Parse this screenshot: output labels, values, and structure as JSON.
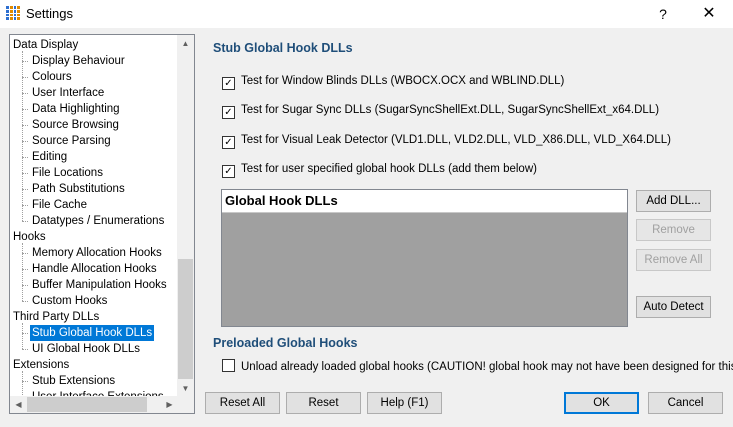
{
  "window": {
    "title": "Settings",
    "help": "?",
    "close": "✕"
  },
  "tree": {
    "items": [
      {
        "label": "Data Display",
        "level": 0
      },
      {
        "label": "Display Behaviour",
        "level": 1
      },
      {
        "label": "Colours",
        "level": 1
      },
      {
        "label": "User Interface",
        "level": 1
      },
      {
        "label": "Data Highlighting",
        "level": 1
      },
      {
        "label": "Source Browsing",
        "level": 1
      },
      {
        "label": "Source Parsing",
        "level": 1
      },
      {
        "label": "Editing",
        "level": 1
      },
      {
        "label": "File Locations",
        "level": 1
      },
      {
        "label": "Path Substitutions",
        "level": 1
      },
      {
        "label": "File Cache",
        "level": 1
      },
      {
        "label": "Datatypes / Enumerations",
        "level": 1
      },
      {
        "label": "Hooks",
        "level": 0
      },
      {
        "label": "Memory Allocation Hooks",
        "level": 1
      },
      {
        "label": "Handle Allocation Hooks",
        "level": 1
      },
      {
        "label": "Buffer Manipulation Hooks",
        "level": 1
      },
      {
        "label": "Custom Hooks",
        "level": 1
      },
      {
        "label": "Third Party DLLs",
        "level": 0
      },
      {
        "label": "Stub Global Hook DLLs",
        "level": 1,
        "selected": true
      },
      {
        "label": "UI Global Hook DLLs",
        "level": 1
      },
      {
        "label": "Extensions",
        "level": 0
      },
      {
        "label": "Stub Extensions",
        "level": 1
      },
      {
        "label": "User Interface Extensions",
        "level": 1
      }
    ]
  },
  "main": {
    "section_title": "Stub Global Hook DLLs",
    "checkboxes": [
      {
        "label": "Test for Window Blinds DLLs (WBOCX.OCX and WBLIND.DLL)",
        "checked": true
      },
      {
        "label": "Test for Sugar Sync DLLs (SugarSyncShellExt.DLL, SugarSyncShellExt_x64.DLL)",
        "checked": true
      },
      {
        "label": "Test for Visual Leak Detector (VLD1.DLL, VLD2.DLL, VLD_X86.DLL, VLD_X64.DLL)",
        "checked": true
      },
      {
        "label": "Test for user specified global hook DLLs (add them below)",
        "checked": true
      }
    ],
    "list_header": "Global Hook DLLs",
    "buttons": {
      "add": "Add DLL...",
      "remove": "Remove",
      "remove_all": "Remove All",
      "auto_detect": "Auto Detect"
    },
    "preloaded_title": "Preloaded Global Hooks",
    "unload": {
      "label": "Unload already loaded global hooks (CAUTION! global hook may not have been designed for this).",
      "checked": false
    }
  },
  "footer": {
    "reset_all": "Reset All",
    "reset": "Reset",
    "help": "Help (F1)",
    "ok": "OK",
    "cancel": "Cancel"
  },
  "colors": {
    "accent": "#0078d7",
    "section_title": "#1f4e79"
  }
}
